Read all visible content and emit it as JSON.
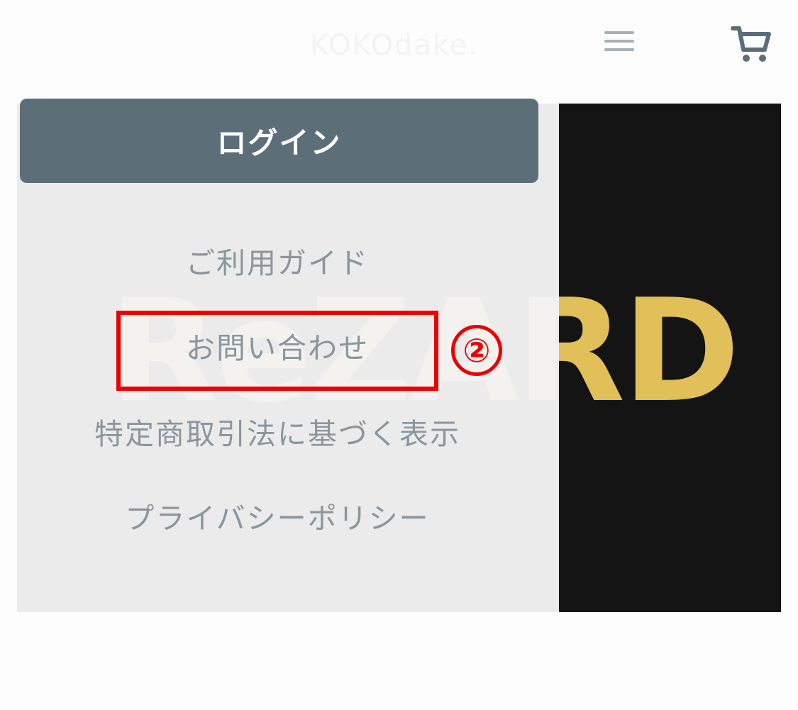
{
  "header": {
    "brand": "KOKOdake.",
    "menu_icon": "hamburger-menu-icon",
    "cart_icon": "shopping-cart-icon"
  },
  "hero": {
    "logo_text": "ReZARD",
    "logo_color": "#e1bf59",
    "background": "#141414"
  },
  "drawer": {
    "login_label": "ログイン",
    "items": [
      {
        "label": "ご利用ガイド"
      },
      {
        "label": "お問い合わせ"
      },
      {
        "label": "特定商取引法に基づく表示"
      },
      {
        "label": "プライバシーポリシー"
      }
    ]
  },
  "annotation": {
    "step_label": "②",
    "highlight_color": "#ee0000"
  }
}
